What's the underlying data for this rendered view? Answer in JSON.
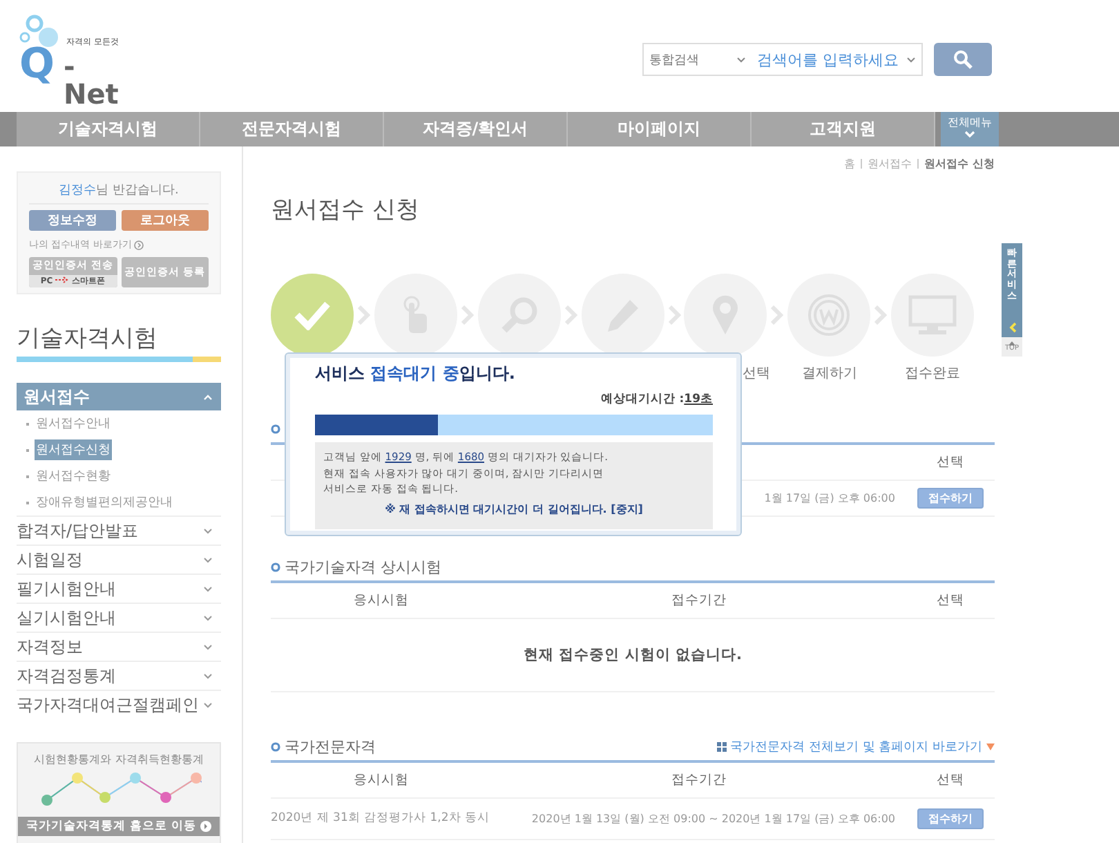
{
  "header": {
    "logo": {
      "tagline": "자격의 모든것",
      "letter": "Q",
      "name": "-Net"
    },
    "search": {
      "scope": "통합검색",
      "placeholder": "검색어를 입력하세요"
    }
  },
  "nav": {
    "items": [
      "기술자격시험",
      "전문자격시험",
      "자격증/확인서",
      "마이페이지",
      "고객지원"
    ],
    "all_menu": "전체메뉴"
  },
  "user_box": {
    "name": "김정수",
    "greeting": "님 반갑습니다.",
    "buttons": [
      {
        "label": "정보수정",
        "kind": "edit"
      },
      {
        "label": "로그아웃",
        "kind": "logout"
      }
    ],
    "history_link": "나의 접수내역 바로가기",
    "cert_buttons": [
      {
        "kind": "transfer",
        "label": "공인인증서 전송",
        "from": "PC",
        "to": "스마트폰"
      },
      {
        "kind": "register",
        "label": "공인인증서 등록"
      }
    ]
  },
  "sidebar": {
    "title": "기술자격시험",
    "menu": [
      {
        "label": "원서접수",
        "expanded": true,
        "children": [
          {
            "label": "원서접수안내",
            "selected": false
          },
          {
            "label": "원서접수신청",
            "selected": true
          },
          {
            "label": "원서접수현황",
            "selected": false
          },
          {
            "label": "장애유형별편의제공안내",
            "selected": false
          }
        ]
      },
      {
        "label": "합격자/답안발표",
        "expanded": false
      },
      {
        "label": "시험일정",
        "expanded": false
      },
      {
        "label": "필기시험안내",
        "expanded": false
      },
      {
        "label": "실기시험안내",
        "expanded": false
      },
      {
        "label": "자격정보",
        "expanded": false
      },
      {
        "label": "자격검정통계",
        "expanded": false
      },
      {
        "label": "국가자격대여근절캠페인",
        "expanded": false
      }
    ]
  },
  "stats_banner": {
    "title": "시험현황통계와 자격취득현황통계",
    "link": "국가기술자격통계 홈으로 이동"
  },
  "breadcrumb": [
    "홈",
    "원서접수",
    "원서접수 신청"
  ],
  "page_title": "원서접수 신청",
  "steps": [
    {
      "done": true
    },
    {
      "done": false
    },
    {
      "done": false
    },
    {
      "done": false
    },
    {
      "done": false,
      "label": "선택"
    },
    {
      "done": false,
      "label": "결제하기"
    },
    {
      "done": false,
      "label": "접수완료"
    }
  ],
  "sections": [
    {
      "columns": {
        "select": "선택"
      },
      "rows": [
        {
          "period": "1월 17일 (금) 오후 06:00",
          "button": "접수하기"
        }
      ]
    },
    {
      "title": "국가기술자격 상시시험",
      "columns": {
        "exam": "응시시험",
        "period": "접수기간",
        "select": "선택"
      },
      "empty_message": "현재 접수중인 시험이 없습니다."
    },
    {
      "title": "국가전문자격",
      "link": "국가전문자격 전체보기 및 홈페이지 바로가기",
      "columns": {
        "exam": "응시시험",
        "period": "접수기간",
        "select": "선택"
      },
      "rows": [
        {
          "exam": "2020년 제 31회 감정평가사 1,2차 동시",
          "period": "2020년 1월 13일 (월) 오전 09:00 ~ 2020년 1월 17일 (금) 오후 06:00",
          "button": "접수하기"
        }
      ]
    }
  ],
  "quick_service": {
    "label": "빠른서비스",
    "top": "TOP"
  },
  "wait_popup": {
    "title": [
      {
        "text": "서비스 ",
        "accent": false
      },
      {
        "text": "접속대기 중",
        "accent": true
      },
      {
        "text": "입니다.",
        "accent": false
      }
    ],
    "eta_label": "예상대기시간 : ",
    "eta": "19초",
    "level": 0.31,
    "message": [
      {
        "text": "고객님 앞에 ",
        "underline": false
      },
      {
        "text": "1929",
        "underline": true
      },
      {
        "text": " 명, 뒤에 ",
        "underline": false
      },
      {
        "text": "1680",
        "underline": true
      },
      {
        "text": " 명의 대기자가 있습니다.\n현재 접속 사용자가 많아 대기 중이며, 잠시만 기다리시면\n서비스로 자동 접속 됩니다.",
        "underline": false
      }
    ],
    "warning": "※ 재 접속하시면 대기시간이 더 길어집니다. [중지]"
  }
}
